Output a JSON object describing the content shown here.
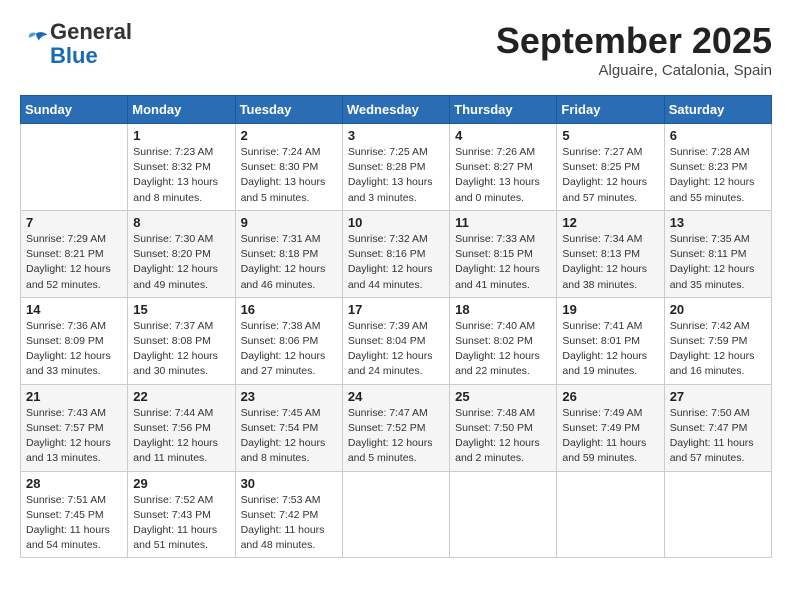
{
  "header": {
    "logo_line1": "General",
    "logo_line2": "Blue",
    "month": "September 2025",
    "location": "Alguaire, Catalonia, Spain"
  },
  "weekdays": [
    "Sunday",
    "Monday",
    "Tuesday",
    "Wednesday",
    "Thursday",
    "Friday",
    "Saturday"
  ],
  "weeks": [
    [
      {
        "day": "",
        "info": ""
      },
      {
        "day": "1",
        "info": "Sunrise: 7:23 AM\nSunset: 8:32 PM\nDaylight: 13 hours\nand 8 minutes."
      },
      {
        "day": "2",
        "info": "Sunrise: 7:24 AM\nSunset: 8:30 PM\nDaylight: 13 hours\nand 5 minutes."
      },
      {
        "day": "3",
        "info": "Sunrise: 7:25 AM\nSunset: 8:28 PM\nDaylight: 13 hours\nand 3 minutes."
      },
      {
        "day": "4",
        "info": "Sunrise: 7:26 AM\nSunset: 8:27 PM\nDaylight: 13 hours\nand 0 minutes."
      },
      {
        "day": "5",
        "info": "Sunrise: 7:27 AM\nSunset: 8:25 PM\nDaylight: 12 hours\nand 57 minutes."
      },
      {
        "day": "6",
        "info": "Sunrise: 7:28 AM\nSunset: 8:23 PM\nDaylight: 12 hours\nand 55 minutes."
      }
    ],
    [
      {
        "day": "7",
        "info": "Sunrise: 7:29 AM\nSunset: 8:21 PM\nDaylight: 12 hours\nand 52 minutes."
      },
      {
        "day": "8",
        "info": "Sunrise: 7:30 AM\nSunset: 8:20 PM\nDaylight: 12 hours\nand 49 minutes."
      },
      {
        "day": "9",
        "info": "Sunrise: 7:31 AM\nSunset: 8:18 PM\nDaylight: 12 hours\nand 46 minutes."
      },
      {
        "day": "10",
        "info": "Sunrise: 7:32 AM\nSunset: 8:16 PM\nDaylight: 12 hours\nand 44 minutes."
      },
      {
        "day": "11",
        "info": "Sunrise: 7:33 AM\nSunset: 8:15 PM\nDaylight: 12 hours\nand 41 minutes."
      },
      {
        "day": "12",
        "info": "Sunrise: 7:34 AM\nSunset: 8:13 PM\nDaylight: 12 hours\nand 38 minutes."
      },
      {
        "day": "13",
        "info": "Sunrise: 7:35 AM\nSunset: 8:11 PM\nDaylight: 12 hours\nand 35 minutes."
      }
    ],
    [
      {
        "day": "14",
        "info": "Sunrise: 7:36 AM\nSunset: 8:09 PM\nDaylight: 12 hours\nand 33 minutes."
      },
      {
        "day": "15",
        "info": "Sunrise: 7:37 AM\nSunset: 8:08 PM\nDaylight: 12 hours\nand 30 minutes."
      },
      {
        "day": "16",
        "info": "Sunrise: 7:38 AM\nSunset: 8:06 PM\nDaylight: 12 hours\nand 27 minutes."
      },
      {
        "day": "17",
        "info": "Sunrise: 7:39 AM\nSunset: 8:04 PM\nDaylight: 12 hours\nand 24 minutes."
      },
      {
        "day": "18",
        "info": "Sunrise: 7:40 AM\nSunset: 8:02 PM\nDaylight: 12 hours\nand 22 minutes."
      },
      {
        "day": "19",
        "info": "Sunrise: 7:41 AM\nSunset: 8:01 PM\nDaylight: 12 hours\nand 19 minutes."
      },
      {
        "day": "20",
        "info": "Sunrise: 7:42 AM\nSunset: 7:59 PM\nDaylight: 12 hours\nand 16 minutes."
      }
    ],
    [
      {
        "day": "21",
        "info": "Sunrise: 7:43 AM\nSunset: 7:57 PM\nDaylight: 12 hours\nand 13 minutes."
      },
      {
        "day": "22",
        "info": "Sunrise: 7:44 AM\nSunset: 7:56 PM\nDaylight: 12 hours\nand 11 minutes."
      },
      {
        "day": "23",
        "info": "Sunrise: 7:45 AM\nSunset: 7:54 PM\nDaylight: 12 hours\nand 8 minutes."
      },
      {
        "day": "24",
        "info": "Sunrise: 7:47 AM\nSunset: 7:52 PM\nDaylight: 12 hours\nand 5 minutes."
      },
      {
        "day": "25",
        "info": "Sunrise: 7:48 AM\nSunset: 7:50 PM\nDaylight: 12 hours\nand 2 minutes."
      },
      {
        "day": "26",
        "info": "Sunrise: 7:49 AM\nSunset: 7:49 PM\nDaylight: 11 hours\nand 59 minutes."
      },
      {
        "day": "27",
        "info": "Sunrise: 7:50 AM\nSunset: 7:47 PM\nDaylight: 11 hours\nand 57 minutes."
      }
    ],
    [
      {
        "day": "28",
        "info": "Sunrise: 7:51 AM\nSunset: 7:45 PM\nDaylight: 11 hours\nand 54 minutes."
      },
      {
        "day": "29",
        "info": "Sunrise: 7:52 AM\nSunset: 7:43 PM\nDaylight: 11 hours\nand 51 minutes."
      },
      {
        "day": "30",
        "info": "Sunrise: 7:53 AM\nSunset: 7:42 PM\nDaylight: 11 hours\nand 48 minutes."
      },
      {
        "day": "",
        "info": ""
      },
      {
        "day": "",
        "info": ""
      },
      {
        "day": "",
        "info": ""
      },
      {
        "day": "",
        "info": ""
      }
    ]
  ]
}
